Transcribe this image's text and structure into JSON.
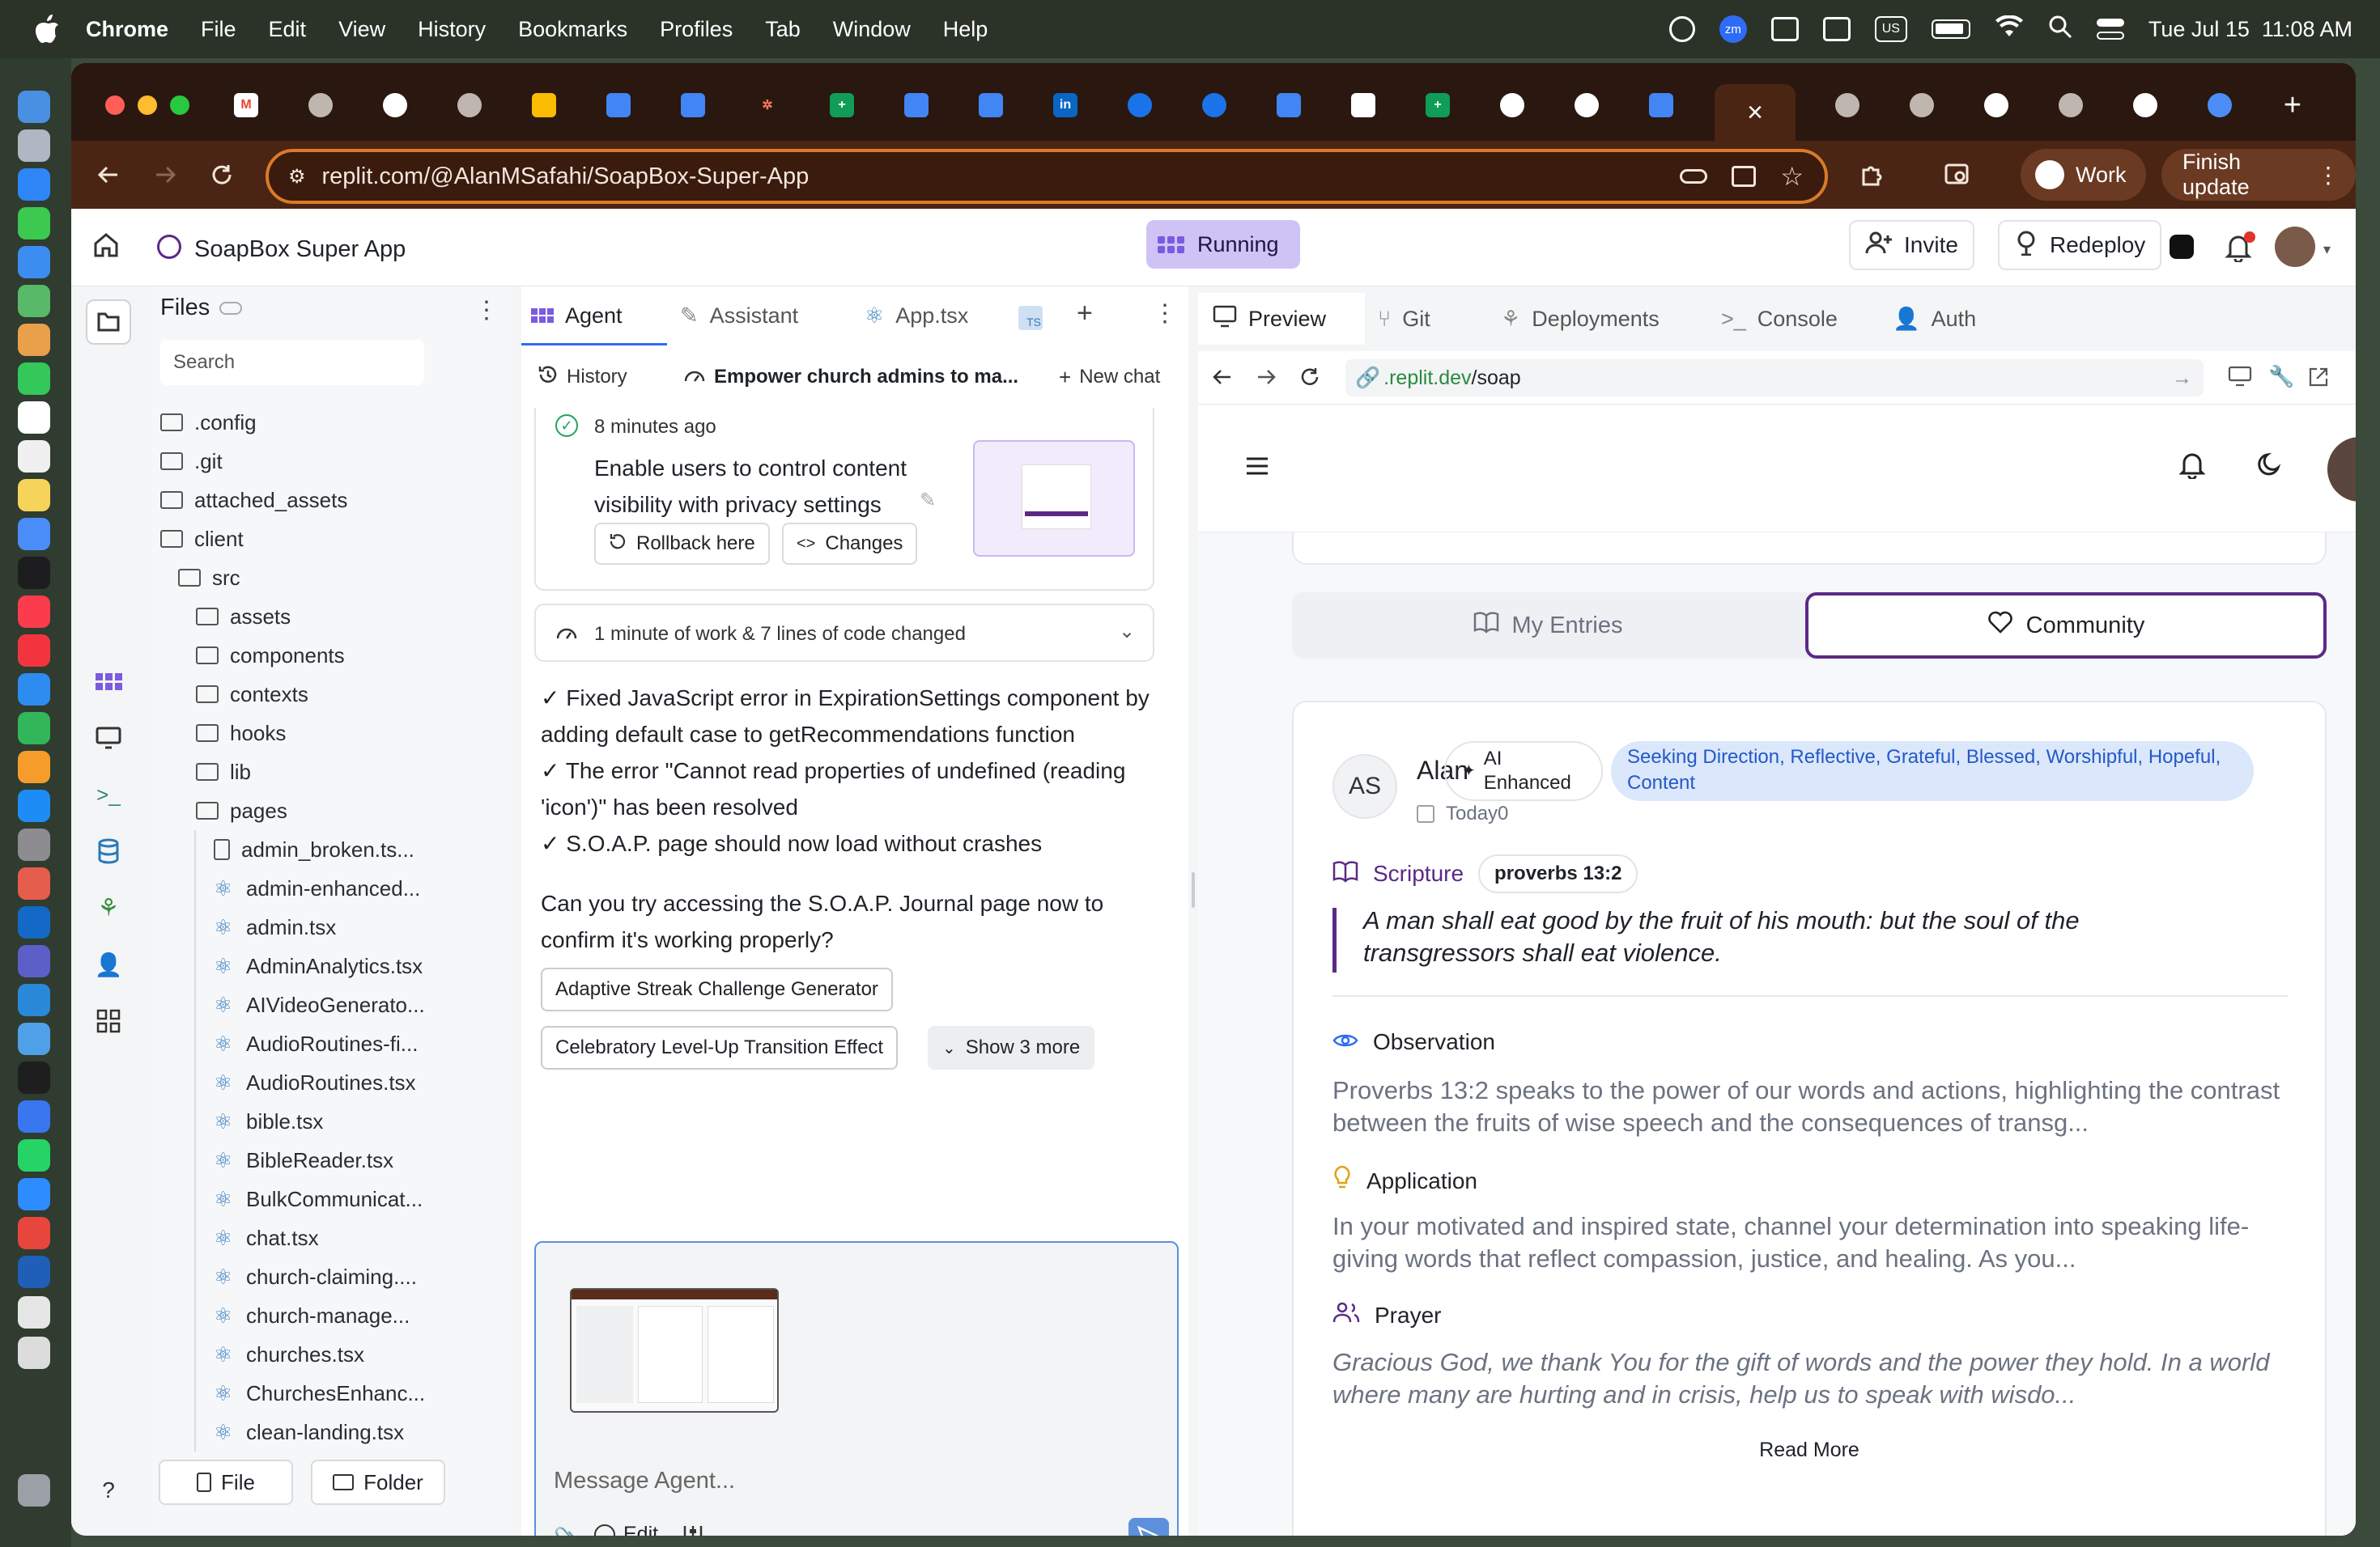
{
  "menubar": {
    "app": "Chrome",
    "items": [
      "File",
      "Edit",
      "View",
      "History",
      "Bookmarks",
      "Profiles",
      "Tab",
      "Window",
      "Help"
    ],
    "clock": "Tue Jul 15  11:08 AM",
    "keyboard": "US",
    "zoom_label": "zm"
  },
  "browser": {
    "url": "replit.com/@AlanMSafahi/SoapBox-Super-App",
    "profile_label": "Work",
    "finish_update_label": "Finish update"
  },
  "replit": {
    "project_name": "SoapBox Super App",
    "status": "Running",
    "invite_label": "Invite",
    "redeploy_label": "Redeploy"
  },
  "files": {
    "title": "Files",
    "search_placeholder": "Search",
    "items": [
      {
        "name": ".config",
        "type": "folder",
        "depth": 0
      },
      {
        "name": ".git",
        "type": "folder",
        "depth": 0
      },
      {
        "name": "attached_assets",
        "type": "folder",
        "depth": 0
      },
      {
        "name": "client",
        "type": "folder",
        "depth": 0
      },
      {
        "name": "src",
        "type": "folder",
        "depth": 1
      },
      {
        "name": "assets",
        "type": "folder",
        "depth": 2
      },
      {
        "name": "components",
        "type": "folder",
        "depth": 2
      },
      {
        "name": "contexts",
        "type": "folder",
        "depth": 2
      },
      {
        "name": "hooks",
        "type": "folder",
        "depth": 2
      },
      {
        "name": "lib",
        "type": "folder",
        "depth": 2
      },
      {
        "name": "pages",
        "type": "folder",
        "depth": 2
      },
      {
        "name": "admin_broken.ts...",
        "type": "file",
        "depth": 3
      },
      {
        "name": "admin-enhanced...",
        "type": "react",
        "depth": 3
      },
      {
        "name": "admin.tsx",
        "type": "react",
        "depth": 3
      },
      {
        "name": "AdminAnalytics.tsx",
        "type": "react",
        "depth": 3
      },
      {
        "name": "AIVideoGenerato...",
        "type": "react",
        "depth": 3
      },
      {
        "name": "AudioRoutines-fi...",
        "type": "react",
        "depth": 3
      },
      {
        "name": "AudioRoutines.tsx",
        "type": "react",
        "depth": 3
      },
      {
        "name": "bible.tsx",
        "type": "react",
        "depth": 3
      },
      {
        "name": "BibleReader.tsx",
        "type": "react",
        "depth": 3
      },
      {
        "name": "BulkCommunicat...",
        "type": "react",
        "depth": 3
      },
      {
        "name": "chat.tsx",
        "type": "react",
        "depth": 3
      },
      {
        "name": "church-claiming....",
        "type": "react",
        "depth": 3
      },
      {
        "name": "church-manage...",
        "type": "react",
        "depth": 3
      },
      {
        "name": "churches.tsx",
        "type": "react",
        "depth": 3
      },
      {
        "name": "ChurchesEnhanc...",
        "type": "react",
        "depth": 3
      },
      {
        "name": "clean-landing.tsx",
        "type": "react",
        "depth": 3
      }
    ],
    "new_file_label": "File",
    "new_folder_label": "Folder"
  },
  "agent": {
    "tabs": [
      "Agent",
      "Assistant",
      "App.tsx"
    ],
    "history_label": "History",
    "chat_title": "Empower church admins to ma...",
    "new_chat_label": "New chat",
    "checkpoint": {
      "time": "8 minutes ago",
      "message": "Enable users to control content visibility with privacy settings",
      "rollback_label": "Rollback here",
      "changes_label": "Changes"
    },
    "work_summary": "1 minute of work & 7 lines of code changed",
    "message_lines": [
      "✓ Fixed JavaScript error in ExpirationSettings component by adding default case to getRecommendations function",
      "✓ The error \"Cannot read properties of undefined (reading 'icon')\" has been resolved",
      "✓ S.O.A.P. page should now load without crashes"
    ],
    "question": "Can you try accessing the S.O.A.P. Journal page now to confirm it's working properly?",
    "suggestions": [
      "Adaptive Streak Challenge Generator",
      "Celebratory Level-Up Transition Effect"
    ],
    "show_more_label": "Show 3 more",
    "composer_placeholder": "Message Agent...",
    "edit_label": "Edit"
  },
  "preview": {
    "tabs": [
      "Preview",
      "Git",
      "Deployments",
      "Console",
      "Auth"
    ],
    "url_prefix": ".replit.dev",
    "url_path": "/soap",
    "segments": {
      "my_entries": "My Entries",
      "community": "Community"
    },
    "entry": {
      "initials": "AS",
      "author": "Alan",
      "ai_badge": "AI Enhanced",
      "moods": "Seeking Direction, Reflective, Grateful, Blessed, Worshipful, Hopeful, Content",
      "date": "Today0",
      "scripture_label": "Scripture",
      "scripture_ref": "proverbs 13:2",
      "verse": "A man shall eat good by the fruit of his mouth: but the soul of the transgressors shall eat violence.",
      "observation_label": "Observation",
      "observation": "Proverbs 13:2 speaks to the power of our words and actions, highlighting the contrast between the fruits of wise speech and the consequences of transg...",
      "application_label": "Application",
      "application": "In your motivated and inspired state, channel your determination into speaking life-giving words that reflect compassion, justice, and healing. As you...",
      "prayer_label": "Prayer",
      "prayer": "Gracious God, we thank You for the gift of words and the power they hold. In a world where many are hurting and in crisis, help us to speak with wisdo...",
      "read_more_label": "Read More"
    }
  },
  "colors": {
    "accent_purple": "#5b2a86",
    "omnibox_border": "#d97b2a",
    "running_bg": "#cfc3f6",
    "mood_badge_bg": "#dbe7fb",
    "mood_badge_text": "#2459c7"
  }
}
